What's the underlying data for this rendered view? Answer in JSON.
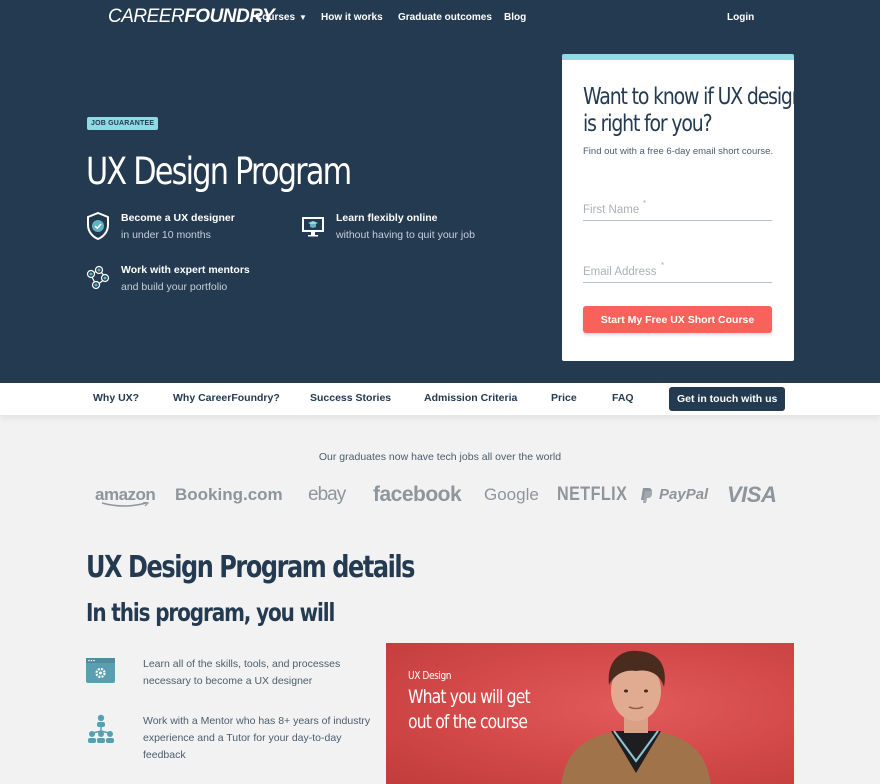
{
  "topnav": {
    "logo_light": "CAREER",
    "logo_bold": "FOUNDRY",
    "items": [
      {
        "label": "Courses",
        "has_dropdown": true
      },
      {
        "label": "How it works"
      },
      {
        "label": "Graduate outcomes"
      },
      {
        "label": "Blog"
      }
    ],
    "login": "Login"
  },
  "hero": {
    "badge": "JOB GUARANTEE",
    "title": "UX Design Program",
    "features": [
      {
        "icon": "shield-check-icon",
        "heading": "Become a UX designer",
        "sub": "in under 10 months"
      },
      {
        "icon": "monitor-graduation-icon",
        "heading": "Learn flexibly online",
        "sub": "without having to quit your job"
      },
      {
        "icon": "mentor-network-icon",
        "heading": "Work with expert mentors",
        "sub": "and build your portfolio"
      }
    ]
  },
  "signup_card": {
    "title_line1": "Want to know if UX design",
    "title_line2": "is right for you?",
    "subtitle": "Find out with a free 6-day email short course.",
    "first_name_placeholder": "First Name",
    "email_placeholder": "Email Address",
    "required_marker": "*",
    "submit_label": "Start My Free UX Short Course"
  },
  "subnav": {
    "items": [
      "Why UX?",
      "Why CareerFoundry?",
      "Success Stories",
      "Admission Criteria",
      "Price",
      "FAQ"
    ],
    "cta": "Get in touch with us"
  },
  "graduates": {
    "text": "Our graduates now have tech jobs all over the world",
    "logos": [
      "amazon",
      "Booking.com",
      "ebay",
      "facebook",
      "Google",
      "NETFLIX",
      "PayPal",
      "VISA"
    ]
  },
  "details": {
    "title": "UX Design Program details",
    "subtitle": "In this program, you will",
    "items": [
      {
        "icon": "browser-gear-icon",
        "text": "Learn all of the skills, tools, and processes necessary to become a UX designer"
      },
      {
        "icon": "mentor-hierarchy-icon",
        "text": "Work with a Mentor who has 8+ years of industry experience and a Tutor for your day-to-day feedback"
      }
    ]
  },
  "video": {
    "category": "UX Design",
    "title_line1": "What you will get",
    "title_line2": "out of the course"
  },
  "colors": {
    "navy": "#243a50",
    "accent_cyan": "#8fdbe3",
    "cta_coral": "#f9625b",
    "icon_teal": "#5a9fb0",
    "video_red": "#d24848"
  }
}
